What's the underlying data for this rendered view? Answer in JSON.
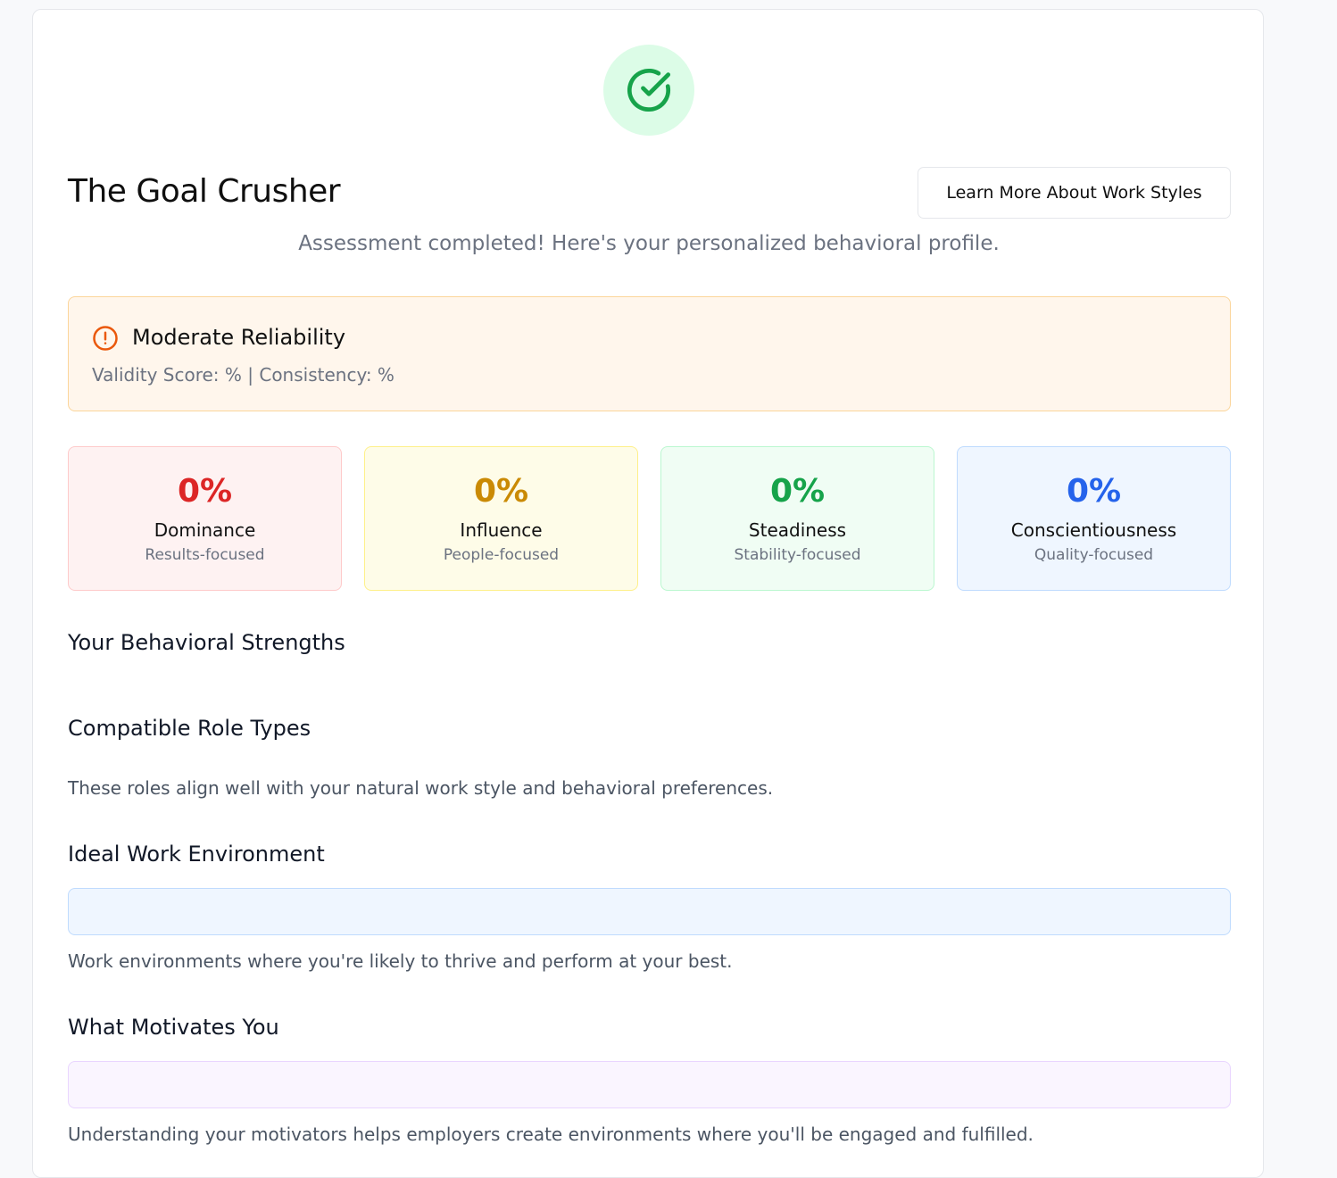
{
  "header": {
    "title": "The Goal Crusher",
    "learn_more_label": "Learn More About Work Styles",
    "subtitle": "Assessment completed! Here's your personalized behavioral profile."
  },
  "reliability": {
    "title": "Moderate Reliability",
    "detail": "Validity Score: % | Consistency: %"
  },
  "scores": [
    {
      "value": "0%",
      "label": "Dominance",
      "sub": "Results-focused",
      "color": "#dc2626",
      "bg": "#fef2f2",
      "border": "#fecaca"
    },
    {
      "value": "0%",
      "label": "Influence",
      "sub": "People-focused",
      "color": "#ca8a04",
      "bg": "#fefce8",
      "border": "#fef08a"
    },
    {
      "value": "0%",
      "label": "Steadiness",
      "sub": "Stability-focused",
      "color": "#16a34a",
      "bg": "#f0fdf4",
      "border": "#bbf7d0"
    },
    {
      "value": "0%",
      "label": "Conscientiousness",
      "sub": "Quality-focused",
      "color": "#2563eb",
      "bg": "#eff6ff",
      "border": "#bfdbfe"
    }
  ],
  "sections": {
    "strengths": {
      "heading": "Your Behavioral Strengths"
    },
    "roles": {
      "heading": "Compatible Role Types",
      "text": "These roles align well with your natural work style and behavioral preferences."
    },
    "environment": {
      "heading": "Ideal Work Environment",
      "text": "Work environments where you're likely to thrive and perform at your best."
    },
    "motivators": {
      "heading": "What Motivates You",
      "text": "Understanding your motivators helps employers create environments where you'll be engaged and fulfilled."
    }
  },
  "colors": {
    "success_bg": "#dcfce7",
    "success": "#16a34a",
    "warning": "#ea580c",
    "environment_box_bg": "#eff6ff",
    "motivators_box_bg": "#faf5ff"
  },
  "icons": {
    "header": "check-circle-icon",
    "reliability": "alert-circle-icon"
  }
}
